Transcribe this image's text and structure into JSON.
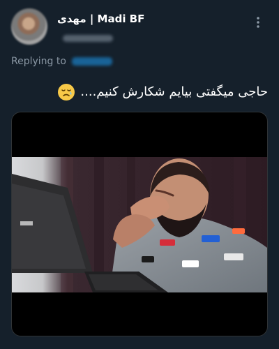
{
  "header": {
    "display_name": "مهدی | Madi BF"
  },
  "reply": {
    "label": "Replying to"
  },
  "tweet": {
    "text": "حاجی میگفتی بیایم شکارش کنیم...."
  },
  "icons": {
    "more": "more-vertical-icon",
    "emoji": "sad-relieved-face-emoji"
  },
  "colors": {
    "background": "#15202b",
    "text": "#ffffff",
    "secondary_text": "#8b98a5",
    "accent": "#1d9bf0"
  }
}
